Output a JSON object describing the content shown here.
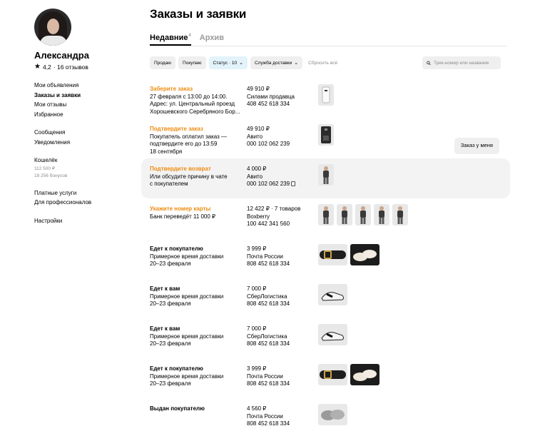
{
  "profile": {
    "name": "Александра",
    "rating": "4,2",
    "reviews": "· 16 отзывов"
  },
  "sidebar": {
    "groups": [
      {
        "items": [
          {
            "label": "Мои объявления",
            "active": false
          },
          {
            "label": "Заказы и заявки",
            "active": true
          },
          {
            "label": "Мои отзывы",
            "active": false
          },
          {
            "label": "Избранное",
            "active": false
          }
        ]
      },
      {
        "items": [
          {
            "label": "Сообщения",
            "active": false
          },
          {
            "label": "Уведомления",
            "active": false
          }
        ]
      }
    ],
    "wallet": {
      "label": "Кошелёк",
      "balance": "112 500 ₽",
      "bonuses": "18 256 бонусов"
    },
    "group3": [
      {
        "label": "Платные услуги"
      },
      {
        "label": "Для профессионалов"
      }
    ],
    "settings": "Настройки"
  },
  "main": {
    "title": "Заказы и заявки",
    "tabs": [
      {
        "label": "Недавние",
        "count": "4",
        "active": true
      },
      {
        "label": "Архив",
        "count": "",
        "active": false
      }
    ],
    "filters": {
      "sell": "Продаю",
      "buy": "Покупаю",
      "status": "Статус · 10",
      "delivery": "Служба доставки",
      "reset": "Сбросить всё",
      "search_placeholder": "Трек-номер или название"
    },
    "action_button": "Заказ у меня"
  },
  "orders": [
    {
      "status": "Заберите заказ",
      "orange": true,
      "details": [
        "27 февраля с 13:00 до 14:00.",
        "Адрес: ул. Центральный проезд",
        "Хорошевского Серебряного Бор..."
      ],
      "price": "49 910 ₽",
      "service": "Силами продавца",
      "track": "408 452 618 334",
      "thumbs": [
        "light"
      ],
      "highlight": false
    },
    {
      "status": "Подтвердите заказ",
      "orange": true,
      "details": [
        "Покупатель оплатил заказ —",
        "подтвердите его до 13:59",
        "18 сентября"
      ],
      "price": "49 910 ₽",
      "service": "Авито",
      "track": "000 102 062 239",
      "thumbs": [
        "machine"
      ],
      "highlight": false,
      "button": true
    },
    {
      "status": "Подтвердите возврат",
      "orange": true,
      "details": [
        "Или обсудите причину в чате",
        "с покупателем"
      ],
      "price": "4 000 ₽",
      "service": "Авито",
      "track": "000 102 062 239",
      "thumbs": [
        "person"
      ],
      "highlight": true,
      "copy": true
    },
    {
      "status": "Укажите номер карты",
      "orange": true,
      "details": [
        "Банк переведёт 11 000 ₽"
      ],
      "price": "12 422 ₽ · 7 товаров",
      "service": "Boxberry",
      "track": "100 442 341 560",
      "thumbs": [
        "person",
        "person",
        "person",
        "person",
        "person"
      ],
      "highlight": false
    },
    {
      "status": "Едет к покупателю",
      "orange": false,
      "details": [
        "Примерное время доставки",
        "20–23 февраля"
      ],
      "price": "3 999 ₽",
      "service": "Почта России",
      "track": "808 452 618 334",
      "thumbs": [
        "belt",
        "shoes-dark"
      ],
      "highlight": false
    },
    {
      "status": "Едет к вам",
      "orange": false,
      "details": [
        "Примерное время доставки",
        "20–23 февраля"
      ],
      "price": "7 000 ₽",
      "service": "СберЛогистика",
      "track": "808 452 618 334",
      "thumbs": [
        "sneaker"
      ],
      "highlight": false
    },
    {
      "status": "Едет к вам",
      "orange": false,
      "details": [
        "Примерное время доставки",
        "20–23 февраля"
      ],
      "price": "7 000 ₽",
      "service": "СберЛогистика",
      "track": "808 452 618 334",
      "thumbs": [
        "sneaker"
      ],
      "highlight": false
    },
    {
      "status": "Едет к покупателю",
      "orange": false,
      "details": [
        "Примерное время доставки",
        "20–23 февраля"
      ],
      "price": "3 999 ₽",
      "service": "Почта России",
      "track": "808 452 618 334",
      "thumbs": [
        "belt",
        "shoes-dark"
      ],
      "highlight": false
    },
    {
      "status": "Выдан покупателю",
      "orange": false,
      "details": [],
      "price": "4 560 ₽",
      "service": "Почта России",
      "track": "808 452 618 334",
      "thumbs": [
        "slippers"
      ],
      "highlight": false
    }
  ]
}
